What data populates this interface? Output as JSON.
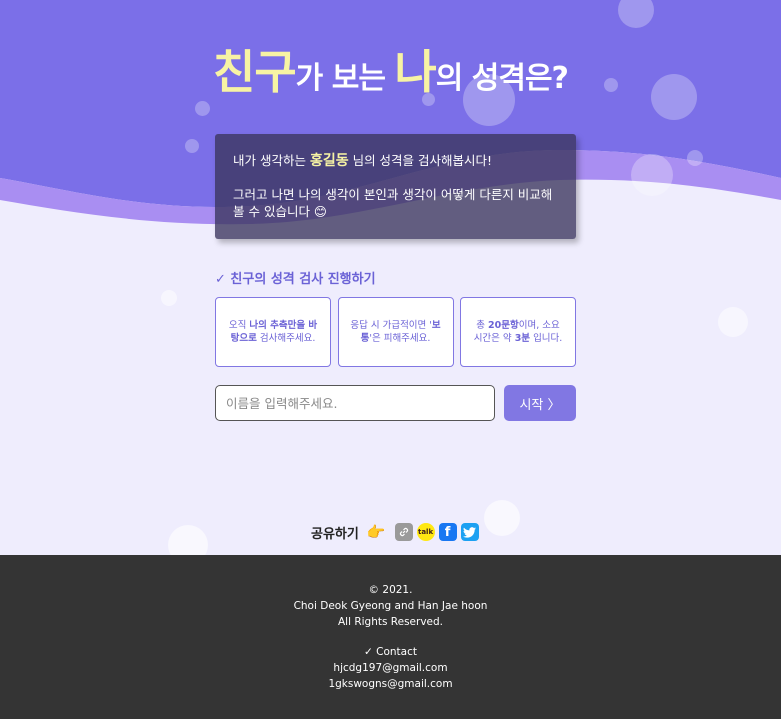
{
  "header": {
    "title_big1": "친구",
    "title_mid": "가 보는 ",
    "title_big2": "나",
    "title_end": "의 성격은?"
  },
  "intro": {
    "line1_prefix": "내가 생각하는 ",
    "name": "홍길동",
    "line1_suffix": " 님의 성격을 검사해봅시다!",
    "line2": "그러고 나면 나의 생각이 본인과 생각이 어떻게 다른지 비교해볼 수 있습니다 😊"
  },
  "section": {
    "title": "✓ 친구의 성격 검사 진행하기"
  },
  "cards": [
    {
      "pre": "오직 ",
      "bold": "나의 추측만을 바탕으로",
      "post": " 검사해주세요."
    },
    {
      "pre": "응답 시 가급적이면 '",
      "bold": "보통",
      "post": "'은 피해주세요."
    },
    {
      "pre": "총 ",
      "bold": "20문항",
      "post": "이며, 소요 시간은 약 ",
      "bold2": "3분",
      "post2": " 입니다."
    }
  ],
  "form": {
    "placeholder": "이름을 입력해주세요.",
    "start_label": "시작 〉"
  },
  "share": {
    "label": "공유하기",
    "pointer": "👉",
    "icons": [
      "link-icon",
      "kakao-icon",
      "facebook-icon",
      "twitter-icon"
    ],
    "kakao_text": "talk",
    "facebook_text": "f",
    "twitter_text": "🐦"
  },
  "footer": {
    "copyright": "© 2021.",
    "authors": "Choi Deok Gyeong and Han Jae hoon",
    "rights": "All Rights Reserved.",
    "contact": "✓ Contact",
    "email1": "hjcdg197@gmail.com",
    "email2": "1gkswogns@gmail.com"
  },
  "colors": {
    "hero": "#7b6fe8",
    "wave": "#a98ef2",
    "accent": "#8177e3",
    "highlight": "#f7f3a4",
    "footer": "#343434"
  }
}
